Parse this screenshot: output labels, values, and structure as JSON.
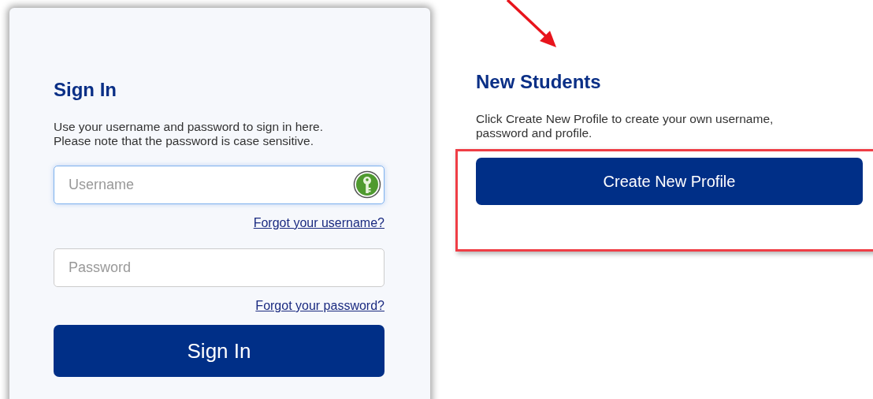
{
  "sign_in": {
    "title": "Sign In",
    "description": "Use your username and password to sign in here.\nPlease note that the password is case sensitive.",
    "fields": [
      {
        "placeholder": "Username",
        "focused": true,
        "link": "Forgot your username?"
      },
      {
        "placeholder": "Password",
        "focused": false,
        "link": "Forgot your password?"
      }
    ],
    "button": "Sign In"
  },
  "new_students": {
    "title": "New Students",
    "description": "Click Create New Profile to create your own username,\npassword and profile.",
    "button": "Create New Profile",
    "highlighted": true
  }
}
